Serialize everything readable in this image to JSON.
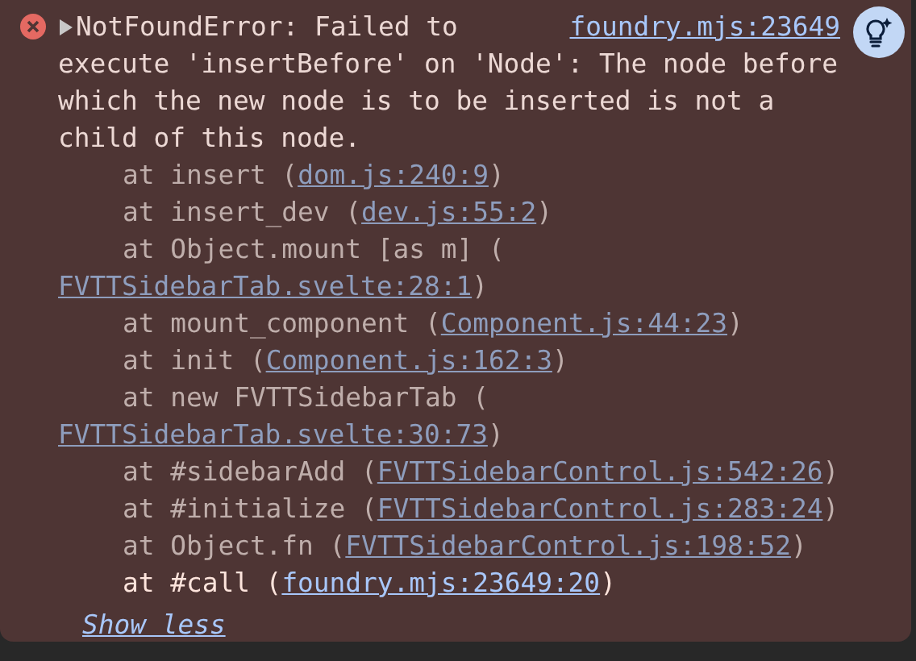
{
  "error": {
    "source": "foundry.mjs:23649",
    "message_lines": [
      "NotFoundError: Failed to",
      "execute 'insertBefore' on 'Node': The node before which the new node is to be inserted is not a child of this node."
    ]
  },
  "stack": [
    {
      "prefix": "at insert (",
      "link": "dom.js:240:9",
      "suffix": ")",
      "ignored": true
    },
    {
      "prefix": "at insert_dev (",
      "link": "dev.js:55:2",
      "suffix": ")",
      "ignored": true
    },
    {
      "prefix": "at Object.mount [as m] (",
      "link": "FVTTSidebarTab.svelte:28:1",
      "suffix": ")",
      "ignored": true
    },
    {
      "prefix": "at mount_component (",
      "link": "Component.js:44:23",
      "suffix": ")",
      "ignored": true
    },
    {
      "prefix": "at init (",
      "link": "Component.js:162:3",
      "suffix": ")",
      "ignored": true
    },
    {
      "prefix": "at new FVTTSidebarTab (",
      "link": "FVTTSidebarTab.svelte:30:73",
      "suffix": ")",
      "ignored": true
    },
    {
      "prefix": "at #sidebarAdd (",
      "link": "FVTTSidebarControl.js:542:26",
      "suffix": ")",
      "ignored": true
    },
    {
      "prefix": "at #initialize (",
      "link": "FVTTSidebarControl.js:283:24",
      "suffix": ")",
      "ignored": true
    },
    {
      "prefix": "at Object.fn (",
      "link": "FVTTSidebarControl.js:198:52",
      "suffix": ")",
      "ignored": true
    },
    {
      "prefix": "at #call (",
      "link": "foundry.mjs:23649:20",
      "suffix": ")",
      "ignored": false
    }
  ],
  "toggle_link": "Show less"
}
